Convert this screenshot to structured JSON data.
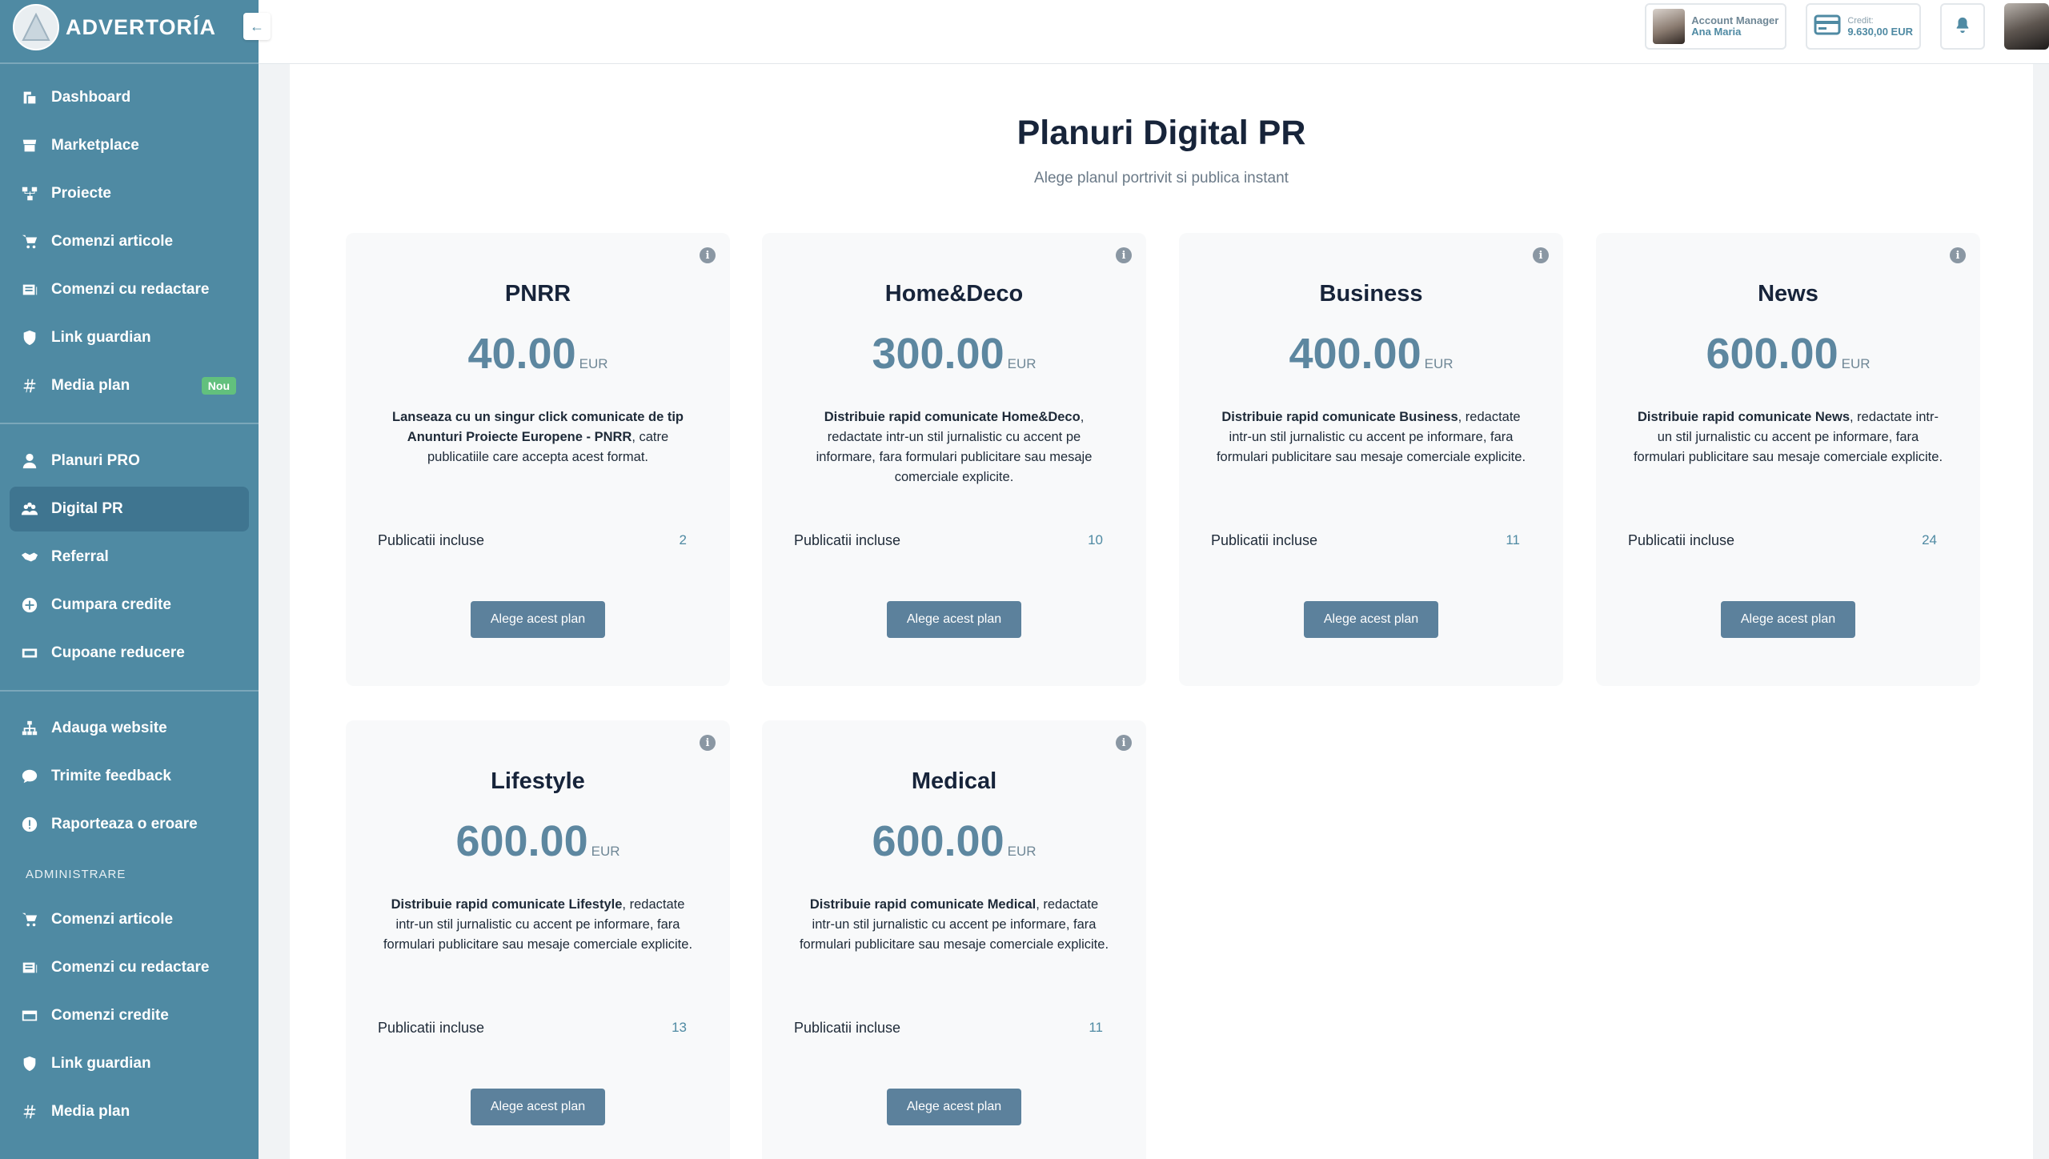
{
  "brand": {
    "name": "ADVERTORÍA",
    "collapse_icon": "arrow-left-icon"
  },
  "sidebar": {
    "items": [
      {
        "label": "Dashboard",
        "icon": "dashboard-icon"
      },
      {
        "label": "Marketplace",
        "icon": "store-icon"
      },
      {
        "label": "Proiecte",
        "icon": "diagram-icon"
      },
      {
        "label": "Comenzi articole",
        "icon": "cart-icon"
      },
      {
        "label": "Comenzi cu redactare",
        "icon": "newspaper-icon"
      },
      {
        "label": "Link guardian",
        "icon": "shield-icon"
      },
      {
        "label": "Media plan",
        "icon": "hash-icon",
        "badge": "Nou"
      }
    ],
    "items2": [
      {
        "label": "Planuri PRO",
        "icon": "user-tie-icon"
      },
      {
        "label": "Digital PR",
        "icon": "people-icon",
        "active": true
      },
      {
        "label": "Referral",
        "icon": "handshake-icon"
      },
      {
        "label": "Cumpara credite",
        "icon": "plus-circle-icon"
      },
      {
        "label": "Cupoane reducere",
        "icon": "ticket-icon"
      }
    ],
    "items3": [
      {
        "label": "Adauga website",
        "icon": "sitemap-icon"
      },
      {
        "label": "Trimite feedback",
        "icon": "comment-icon"
      },
      {
        "label": "Raporteaza o eroare",
        "icon": "exclamation-circle-icon"
      }
    ],
    "admin_section": "ADMINISTRARE",
    "admin_items": [
      {
        "label": "Comenzi articole",
        "icon": "cart-icon"
      },
      {
        "label": "Comenzi cu redactare",
        "icon": "newspaper-icon"
      },
      {
        "label": "Comenzi credite",
        "icon": "credit-card-icon"
      },
      {
        "label": "Link guardian",
        "icon": "shield-icon"
      },
      {
        "label": "Media plan",
        "icon": "hash-icon"
      }
    ]
  },
  "topbar": {
    "account_manager_label": "Account Manager",
    "account_manager_name": "Ana Maria",
    "credit_label": "Credit:",
    "credit_value": "9.630,00 EUR"
  },
  "main": {
    "title": "Planuri Digital PR",
    "subtitle": "Alege planul portrivit si publica instant",
    "currency": "EUR",
    "included_label": "Publicatii incluse",
    "button_label": "Alege acest plan",
    "plans": [
      {
        "name": "PNRR",
        "price": "40.00",
        "desc_bold": "Lanseaza cu un singur click comunicate de tip Anunturi Proiecte Europene - PNRR",
        "desc_rest": ", catre publicatiile care accepta acest format.",
        "count": "2"
      },
      {
        "name": "Home&Deco",
        "price": "300.00",
        "desc_bold": "Distribuie rapid comunicate Home&Deco",
        "desc_rest": ", redactate intr-un stil jurnalistic cu accent pe informare, fara formulari publicitare sau mesaje comerciale explicite.",
        "count": "10"
      },
      {
        "name": "Business",
        "price": "400.00",
        "desc_bold": "Distribuie rapid comunicate Business",
        "desc_rest": ", redactate intr-un stil jurnalistic cu accent pe informare, fara formulari publicitare sau mesaje comerciale explicite.",
        "count": "11"
      },
      {
        "name": "News",
        "price": "600.00",
        "desc_bold": "Distribuie rapid comunicate News",
        "desc_rest": ", redactate intr-un stil jurnalistic cu accent pe informare, fara formulari publicitare sau mesaje comerciale explicite.",
        "count": "24"
      },
      {
        "name": "Lifestyle",
        "price": "600.00",
        "desc_bold": "Distribuie rapid comunicate Lifestyle",
        "desc_rest": ", redactate intr-un stil jurnalistic cu accent pe informare, fara formulari publicitare sau mesaje comerciale explicite.",
        "count": "13"
      },
      {
        "name": "Medical",
        "price": "600.00",
        "desc_bold": "Distribuie rapid comunicate Medical",
        "desc_rest": ", redactate intr-un stil jurnalistic cu accent pe informare, fara formulari publicitare sau mesaje comerciale explicite.",
        "count": "11"
      }
    ]
  },
  "colors": {
    "sidebar": "#4f8aa3",
    "accent": "#5c819c",
    "badge": "#62c07d"
  }
}
